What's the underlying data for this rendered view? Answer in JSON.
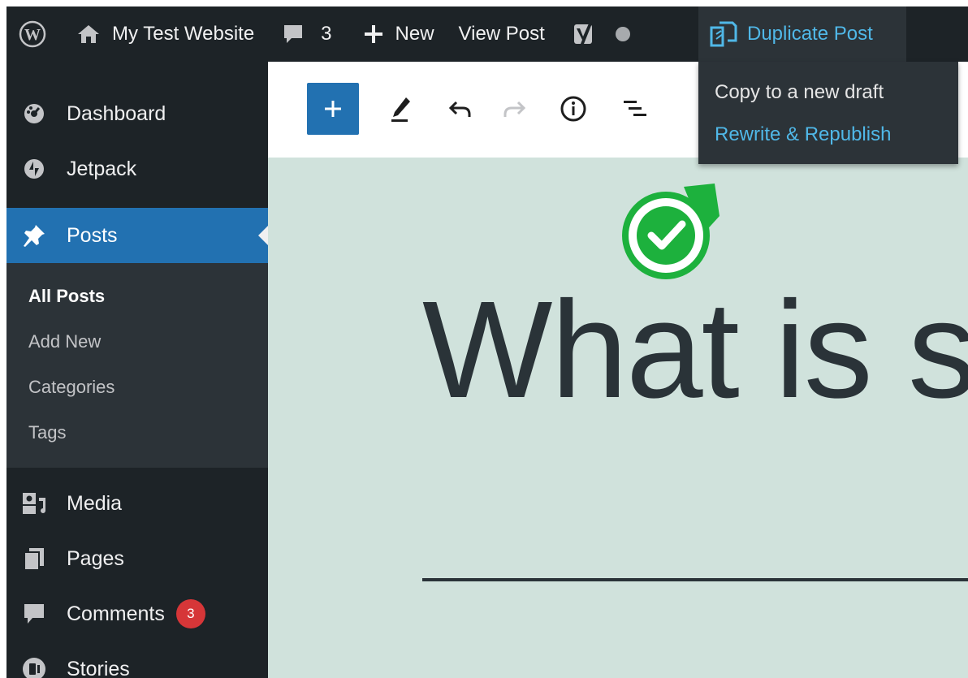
{
  "admin_bar": {
    "site_name": "My Test Website",
    "comments_count": "3",
    "new_label": "New",
    "view_post_label": "View Post",
    "duplicate_post_label": "Duplicate Post"
  },
  "duplicate_menu": {
    "items": [
      {
        "label": "Copy to a new draft"
      },
      {
        "label": "Rewrite & Republish"
      }
    ]
  },
  "sidebar": {
    "items": [
      {
        "label": "Dashboard",
        "icon": "dashboard-icon"
      },
      {
        "label": "Jetpack",
        "icon": "jetpack-icon"
      },
      {
        "label": "Posts",
        "icon": "pin-icon",
        "active": true
      },
      {
        "label": "Media",
        "icon": "media-icon"
      },
      {
        "label": "Pages",
        "icon": "pages-icon"
      },
      {
        "label": "Comments",
        "icon": "comment-icon",
        "badge": "3"
      },
      {
        "label": "Stories",
        "icon": "stories-icon"
      }
    ],
    "posts_submenu": [
      {
        "label": "All Posts",
        "current": true
      },
      {
        "label": "Add New"
      },
      {
        "label": "Categories"
      },
      {
        "label": "Tags"
      }
    ]
  },
  "editor": {
    "toolbar": [
      "add-block",
      "edit-tools",
      "undo",
      "redo",
      "details",
      "list-view"
    ],
    "title": "What is s"
  },
  "colors": {
    "admin_bar_bg": "#1d2327",
    "active_menu": "#2271b1",
    "link_blue": "#50b8e8",
    "badge_red": "#d63638",
    "editor_bg": "#d0e2dc",
    "marker_green": "#1db13d"
  }
}
